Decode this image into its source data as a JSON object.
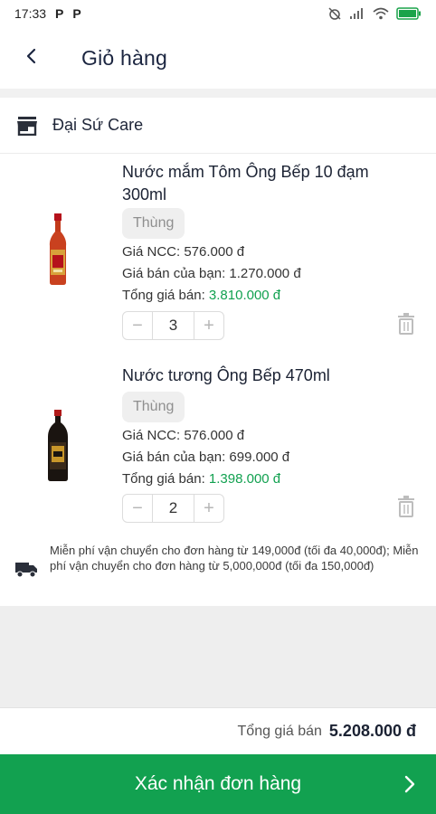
{
  "status_bar": {
    "time": "17:33",
    "notif_1": "P",
    "notif_2": "P"
  },
  "header": {
    "title": "Giỏ hàng",
    "back_icon": "chevron-left-icon"
  },
  "shop": {
    "name": "Đại Sứ Care",
    "icon": "store-icon"
  },
  "items": [
    {
      "name": "Nước mắm Tôm Ông Bếp 10 đạm 300ml",
      "unit": "Thùng",
      "supplier_price": "Giá NCC: 576.000 đ",
      "your_price": "Giá bán của bạn: 1.270.000 đ",
      "total_label": "Tổng giá bán: ",
      "total_value": "3.810.000 đ",
      "quantity": "3",
      "minus": "−",
      "plus": "+"
    },
    {
      "name": "Nước tương Ông Bếp 470ml",
      "unit": "Thùng",
      "supplier_price": "Giá NCC: 576.000 đ",
      "your_price": "Giá bán của bạn: 699.000 đ",
      "total_label": "Tổng giá bán: ",
      "total_value": "1.398.000 đ",
      "quantity": "2",
      "minus": "−",
      "plus": "+"
    }
  ],
  "shipping": {
    "icon": "truck-icon",
    "note": "Miễn phí vận chuyển cho đơn hàng từ 149,000đ (tối đa 40,000đ); Miễn phí vận chuyển cho đơn hàng từ 5,000,000đ (tối đa 150,000đ)"
  },
  "summary": {
    "total_label": "Tổng giá bán",
    "total_value": "5.208.000 đ"
  },
  "confirm_button": {
    "label": "Xác nhận đơn hàng"
  },
  "colors": {
    "accent": "#12a150",
    "separator": "#eeeeee"
  }
}
